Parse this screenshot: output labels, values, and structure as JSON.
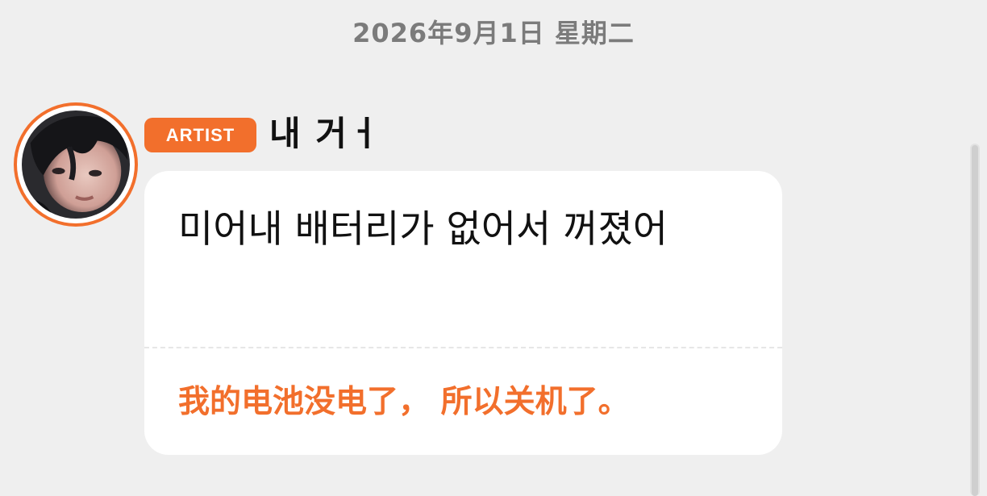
{
  "date_header": "2026年9月1日  星期二",
  "message": {
    "badge_label": "ARTIST",
    "sender_name": "내 거ㅓ",
    "text": "미어내 배터리가 없어서 꺼졌어",
    "translation": "我的电池没电了， 所以关机了。",
    "avatar_icon": "profile-photo"
  },
  "colors": {
    "accent": "#f26f2c",
    "background": "#efefef",
    "bubble": "#ffffff",
    "date_text": "#7b7b7b"
  }
}
